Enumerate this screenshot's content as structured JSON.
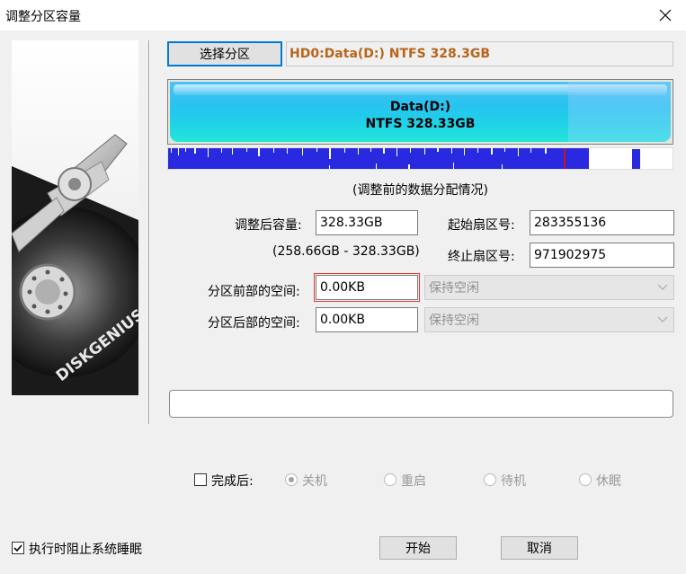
{
  "window": {
    "title": "调整分区容量"
  },
  "actions": {
    "select_partition": "选择分区",
    "start": "开始",
    "cancel": "取消"
  },
  "partition": {
    "path": "HD0:Data(D:) NTFS 328.3GB",
    "name": "Data(D:)",
    "fs_size": "NTFS 328.33GB"
  },
  "caption": "(调整前的数据分配情况)",
  "form": {
    "size_after_label": "调整后容量:",
    "size_after_value": "328.33GB",
    "size_range": "(258.66GB - 328.33GB)",
    "start_sector_label": "起始扇区号:",
    "start_sector_value": "283355136",
    "end_sector_label": "终止扇区号:",
    "end_sector_value": "971902975",
    "space_before_label": "分区前部的空间:",
    "space_before_value": "0.00KB",
    "space_before_mode": "保持空闲",
    "space_after_label": "分区后部的空间:",
    "space_after_value": "0.00KB",
    "space_after_mode": "保持空闲"
  },
  "completion": {
    "label": "完成后:",
    "options": [
      "关机",
      "重启",
      "待机",
      "休眠"
    ],
    "selected": "关机"
  },
  "prevent_sleep": {
    "label": "执行时阻止系统睡眠",
    "checked": true
  },
  "graphic": {
    "brand": "DISKGENIUS"
  },
  "colors": {
    "path_text": "#b8651b",
    "partition_fill": "#27c3ef",
    "data_blocks": "#2929e0",
    "boundary_marker": "#d01010"
  }
}
